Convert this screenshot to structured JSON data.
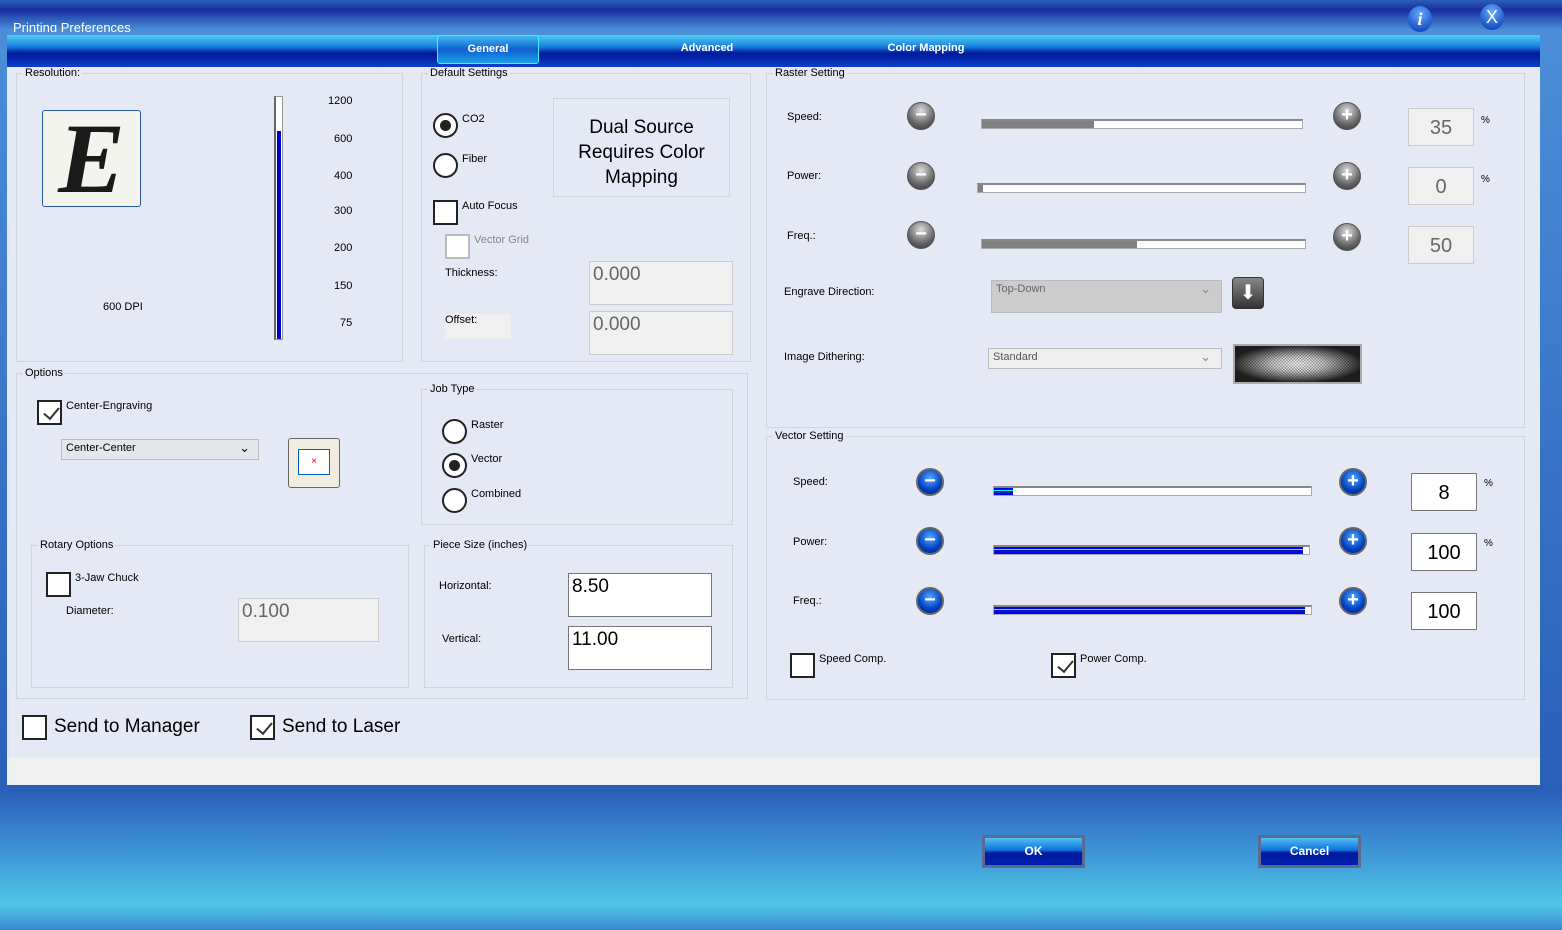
{
  "window": {
    "title": "Printing Preferences"
  },
  "tabs": [
    {
      "label": "General"
    },
    {
      "label": "Advanced"
    },
    {
      "label": "Color Mapping"
    }
  ],
  "resolution": {
    "label": "Resolution:",
    "dpi_text": "600 DPI",
    "ticks": [
      "1200",
      "600",
      "400",
      "300",
      "200",
      "150",
      "75"
    ],
    "slider_fraction": 0.86
  },
  "default_settings": {
    "label": "Default Settings",
    "co2": "CO2",
    "fiber": "Fiber",
    "note": "Dual Source Requires Color Mapping",
    "auto_focus": "Auto Focus",
    "vector_grid": "Vector Grid",
    "thickness_label": "Thickness:",
    "thickness": "0.000",
    "offset_label": "Offset:",
    "offset": "0.000"
  },
  "options": {
    "label": "Options",
    "center_engraving": "Center-Engraving",
    "center_mode": "Center-Center"
  },
  "job_type": {
    "label": "Job Type",
    "raster": "Raster",
    "vector": "Vector",
    "combined": "Combined"
  },
  "rotary": {
    "label": "Rotary Options",
    "three_jaw": "3-Jaw Chuck",
    "diameter_label": "Diameter:",
    "diameter": "0.100"
  },
  "piece_size": {
    "label": "Piece Size (inches)",
    "horizontal_label": "Horizontal:",
    "horizontal": "8.50",
    "vertical_label": "Vertical:",
    "vertical": "11.00"
  },
  "raster": {
    "label": "Raster Setting",
    "speed_label": "Speed:",
    "speed": "35",
    "power_label": "Power:",
    "power": "0",
    "freq_label": "Freq.:",
    "freq": "50",
    "pct": "%",
    "engrave_dir_label": "Engrave Direction:",
    "engrave_dir": "Top-Down",
    "dither_label": "Image Dithering:",
    "dither": "Standard"
  },
  "vector": {
    "label": "Vector Setting",
    "speed_label": "Speed:",
    "speed": "8",
    "power_label": "Power:",
    "power": "100",
    "freq_label": "Freq.:",
    "freq": "100",
    "pct": "%",
    "speed_comp": "Speed Comp.",
    "power_comp": "Power Comp."
  },
  "send": {
    "manager": "Send to Manager",
    "laser": "Send to Laser"
  },
  "buttons": {
    "ok": "OK",
    "cancel": "Cancel"
  },
  "colors": {
    "accent": "#0020c0",
    "panel": "#e4e9f5"
  }
}
